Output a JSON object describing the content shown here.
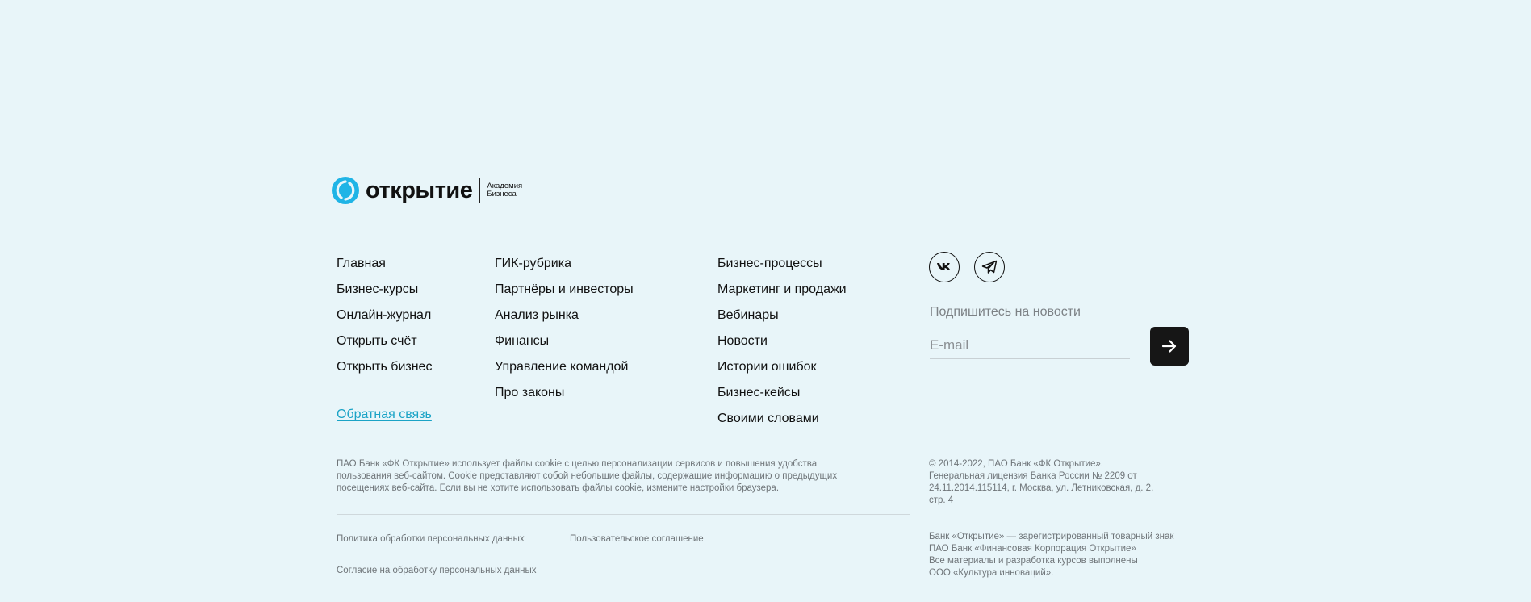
{
  "logo": {
    "wordmark": "открытие",
    "subtitle_line1": "Академия",
    "subtitle_line2": "Бизнеса",
    "icon": "otkritie-logo-icon",
    "accent_color": "#1fb4e6"
  },
  "nav": {
    "col1": [
      "Главная",
      "Бизнес-курсы",
      "Онлайн-журнал",
      "Открыть счёт",
      "Открыть бизнес"
    ],
    "col2": [
      "ГИК-рубрика",
      "Партнёры и инвесторы",
      "Анализ рынка",
      "Финансы",
      "Управление командой",
      "Про законы"
    ],
    "col3": [
      "Бизнес-процессы",
      "Маркетинг и продажи",
      "Вебинары",
      "Новости",
      "Истории ошибок",
      "Бизнес-кейсы",
      "Своими словами"
    ],
    "feedback": "Обратная связь",
    "feedback_color": "#1aa3c6"
  },
  "social": {
    "vk_icon": "vk-icon",
    "telegram_icon": "telegram-icon"
  },
  "subscribe": {
    "title": "Подпишитесь на новости",
    "placeholder": "E-mail",
    "submit_icon": "arrow-right-icon"
  },
  "legal": {
    "cookie_lines": [
      "ПАО Банк «ФК Открытие» использует файлы cookie с целью персонализации сервисов и повышения удобства",
      "пользования веб-сайтом. Cookie представляют собой небольшие файлы, содержащие информацию о предыдущих",
      "посещениях веб-сайта. Если вы не хотите использовать файлы cookie, измените настройки браузера."
    ],
    "privacy_policy": "Политика обработки персональных данных",
    "user_agreement": "Пользовательское соглашение",
    "consent": "Согласие на обработку персональных данных",
    "copyright_lines": [
      "© 2014-2022, ПАО Банк «ФК Открытие».",
      "Генеральная лицензия Банка России № 2209 от",
      "24.11.2014.115114, г. Москва, ул. Летниковская, д. 2,",
      "стр. 4"
    ],
    "trademark_lines": [
      "Банк «Открытие» — зарегистрированный товарный знак",
      "ПАО Банк «Финансовая Корпорация Открытие»",
      "Все материалы и разработка курсов выполнены",
      "ООО «Культура инноваций»."
    ]
  }
}
